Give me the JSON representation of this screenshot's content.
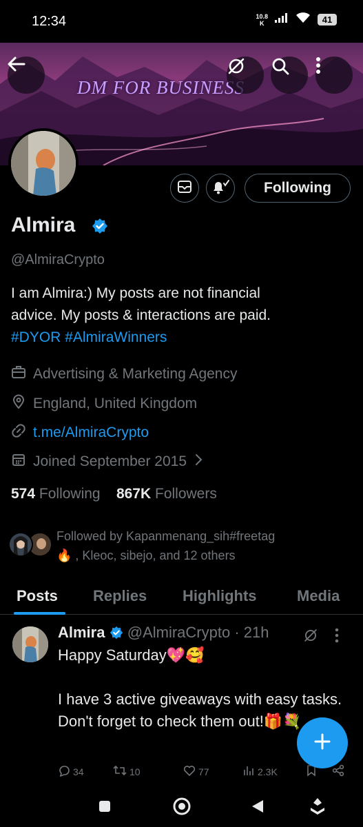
{
  "status_bar": {
    "time": "12:34",
    "net_speed_top": "10.8",
    "net_speed_bottom": "K",
    "battery": "41"
  },
  "banner": {
    "text": "DM FOR BUSINESS"
  },
  "profile": {
    "name": "Almira",
    "handle": "@AlmiraCrypto",
    "bio_line1": "I am Almira:) My posts are not financial",
    "bio_line2": "advice. My posts & interactions are paid.",
    "hashtag1": "#DYOR",
    "hashtag2": "#AlmiraWinners",
    "category": "Advertising & Marketing Agency",
    "location": "England, United Kingdom",
    "website": "t.me/AlmiraCrypto",
    "joined": "Joined September 2015",
    "following_count": "574",
    "following_label": "Following",
    "followers_count": "867K",
    "followers_label": "Followers",
    "followed_by_line1": "Followed by Kapanmenang_sih#freetag",
    "followed_by_line2": "🔥 , Kleoc, sibejo, and 12 others",
    "following_button": "Following"
  },
  "tabs": [
    "Posts",
    "Replies",
    "Highlights",
    "Media"
  ],
  "post": {
    "name": "Almira",
    "handle": "@AlmiraCrypto",
    "time": " · 21h",
    "text": "Happy Saturday💖🥰\n\n I have 3 active giveaways with easy tasks. Don't forget to check them out!🎁💐",
    "replies": "34",
    "reposts": "10",
    "likes": "77",
    "views": "2.3K"
  },
  "colors": {
    "accent": "#1d9bf0",
    "background": "#000000",
    "text": "#e7e9ea",
    "muted": "#71767b"
  }
}
